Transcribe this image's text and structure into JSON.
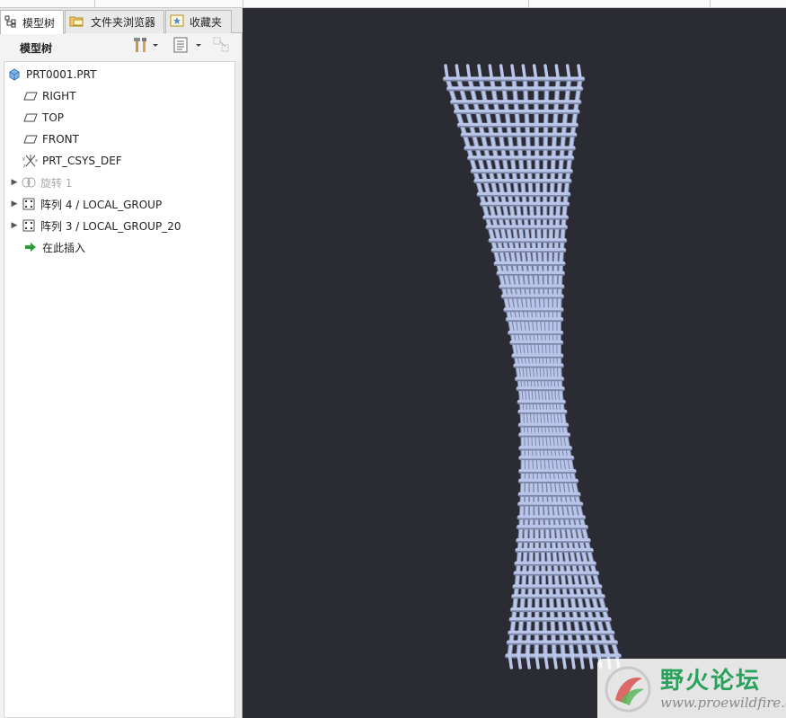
{
  "tabs": [
    {
      "label": "模型树",
      "icon": "model-tree-icon",
      "active": true
    },
    {
      "label": "文件夹浏览器",
      "icon": "folder-browser-icon",
      "active": false
    },
    {
      "label": "收藏夹",
      "icon": "favorites-icon",
      "active": false
    }
  ],
  "toolbar": {
    "title": "模型树",
    "settings_icon": "tools-icon",
    "show_icon": "show-list-icon",
    "filter_icon": "tree-filter-icon"
  },
  "tree": [
    {
      "label": "PRT0001.PRT",
      "icon": "part-icon",
      "expandable": false
    },
    {
      "label": "RIGHT",
      "icon": "datum-plane-icon",
      "expandable": false
    },
    {
      "label": "TOP",
      "icon": "datum-plane-icon",
      "expandable": false
    },
    {
      "label": "FRONT",
      "icon": "datum-plane-icon",
      "expandable": false
    },
    {
      "label": "PRT_CSYS_DEF",
      "icon": "coordinate-system-icon",
      "expandable": false
    },
    {
      "label": "旋转 1",
      "icon": "revolve-icon",
      "expandable": true,
      "suppressed": true
    },
    {
      "label": "阵列 4 / LOCAL_GROUP",
      "icon": "pattern-icon",
      "expandable": true
    },
    {
      "label": "阵列 3 / LOCAL_GROUP_20",
      "icon": "pattern-icon",
      "expandable": true
    },
    {
      "label": "在此插入",
      "icon": "insert-here-arrow-icon",
      "expandable": false
    }
  ],
  "viewport": {
    "background": "#2b2b33",
    "model_color": "#b9c6ea",
    "model_shadow": "#7d88a8",
    "model": "hyperboloid lattice tower"
  },
  "watermark": {
    "title": "野火论坛",
    "url": "www.proewildfire.cn",
    "accent": "#2aa15c"
  }
}
